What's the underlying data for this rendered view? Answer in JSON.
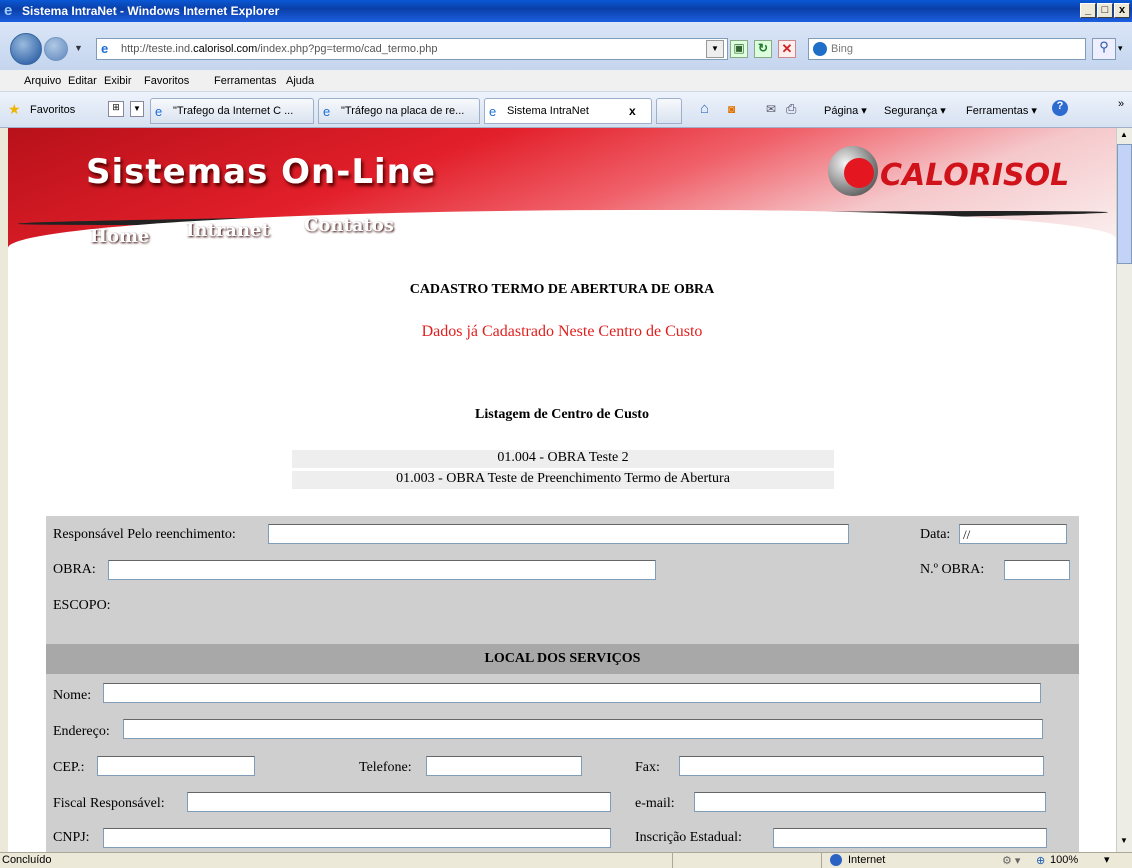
{
  "window": {
    "title": "Sistema IntraNet - Windows Internet Explorer",
    "min": "_",
    "max": "□",
    "close": "x"
  },
  "address": {
    "url_prefix": "http://teste.ind.",
    "url_domain": "calorisol.com",
    "url_suffix": "/index.php?pg=termo/cad_termo.php",
    "search_placeholder": "Bing"
  },
  "menu": [
    "Arquivo",
    "Editar",
    "Exibir",
    "Favoritos",
    "Ferramentas",
    "Ajuda"
  ],
  "favorites": {
    "label": "Favoritos"
  },
  "tabs": [
    "\"Trafego da Internet C ...",
    "\"Tráfego na placa de re...",
    "Sistema IntraNet"
  ],
  "tab_close": "x",
  "toolbar": {
    "pagina": "Página ▾",
    "seguranca": "Segurança ▾",
    "ferramentas": "Ferramentas ▾"
  },
  "banner": {
    "title": "Sistemas On-Line",
    "logo": "CALORISOL",
    "nav": [
      "Home",
      "Intranet",
      "Contatos"
    ]
  },
  "page": {
    "heading": "CADASTRO TERMO DE ABERTURA DE OBRA",
    "alert": "Dados já Cadastrado Neste Centro de Custo",
    "list_title": "Listagem de Centro de Custo",
    "list": [
      "01.004 - OBRA Teste 2",
      "01.003 - OBRA Teste de Preenchimento Termo de Abertura"
    ],
    "alert_color": "#e0201e"
  },
  "form": {
    "responsavel_label": "Responsável Pelo reenchimento:",
    "responsavel_value": "",
    "data_label": "Data:",
    "data_value": "//",
    "obra_label": "OBRA:",
    "obra_value": "",
    "nobra_label": "N.º OBRA:",
    "nobra_value": "",
    "escopo_label": "ESCOPO:",
    "section_title": "LOCAL DOS SERVIÇOS",
    "nome_label": "Nome:",
    "endereco_label": "Endereço:",
    "cep_label": "CEP.:",
    "telefone_label": "Telefone:",
    "fax_label": "Fax:",
    "fiscal_label": "Fiscal Responsável:",
    "email_label": "e-mail:",
    "cnpj_label": "CNPJ:",
    "ie_label": "Inscrição Estadual:"
  },
  "status": {
    "text": "Concluído",
    "zone": "Internet",
    "zoom": "100%"
  }
}
